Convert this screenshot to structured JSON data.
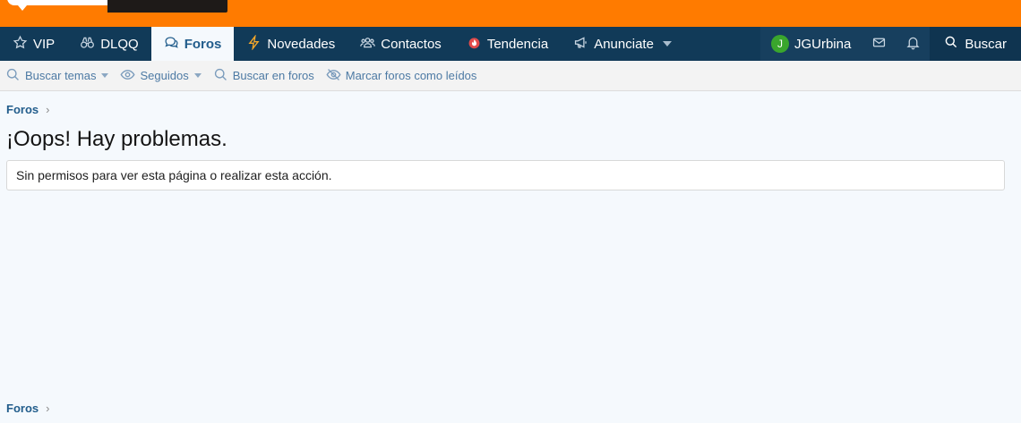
{
  "nav": {
    "tabs": [
      {
        "label": "VIP",
        "icon": "star-icon"
      },
      {
        "label": "DLQQ",
        "icon": "binoculars-icon"
      },
      {
        "label": "Foros",
        "icon": "comments-icon",
        "active": true
      },
      {
        "label": "Novedades",
        "icon": "bolt-icon"
      },
      {
        "label": "Contactos",
        "icon": "users-icon"
      },
      {
        "label": "Tendencia",
        "icon": "fire-icon"
      },
      {
        "label": "Anunciate",
        "icon": "megaphone-icon"
      }
    ],
    "user": {
      "initial": "J",
      "name": "JGUrbina"
    },
    "search_label": "Buscar"
  },
  "subnav": {
    "items": [
      {
        "label": "Buscar temas"
      },
      {
        "label": "Seguidos"
      },
      {
        "label": "Buscar en foros"
      },
      {
        "label": "Marcar foros como leídos"
      }
    ]
  },
  "main": {
    "breadcrumb": "Foros",
    "chevron": "›",
    "title": "¡Oops! Hay problemas.",
    "error_message": "Sin permisos para ver esta página o realizar esta acción."
  },
  "colors": {
    "brand_orange": "#ff7b00",
    "nav_bg": "#113a58",
    "link_blue": "#225d8c"
  }
}
